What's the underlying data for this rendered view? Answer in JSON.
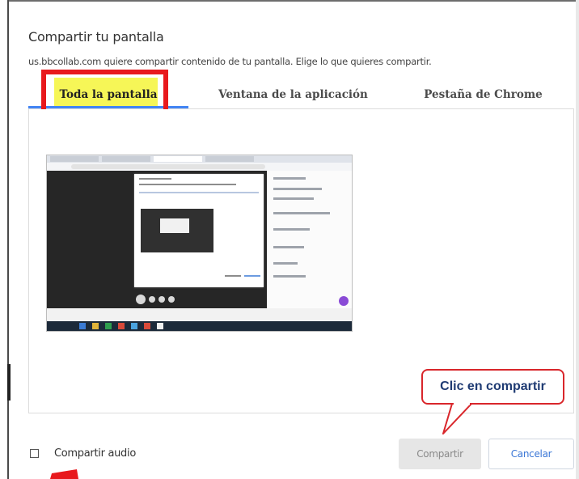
{
  "dialog": {
    "title": "Compartir tu pantalla",
    "subtitle": "us.bbcollab.com quiere compartir contenido de tu pantalla. Elige lo que quieres compartir."
  },
  "tabs": [
    {
      "label": "Toda la pantalla",
      "active": true
    },
    {
      "label": "Ventana de la aplicación",
      "active": false
    },
    {
      "label": "Pestaña de Chrome",
      "active": false
    }
  ],
  "preview": {
    "icon": "screen-thumbnail"
  },
  "callout": {
    "text": "Clic en compartir",
    "border_color": "#d9262b",
    "text_color": "#1f3b73"
  },
  "footer": {
    "audio_label": "Compartir audio",
    "audio_checked": false,
    "share_label": "Compartir",
    "cancel_label": "Cancelar"
  },
  "colors": {
    "accent": "#4285f4",
    "highlight_border": "#e8191d",
    "highlight_fill": "#f5f53a"
  }
}
